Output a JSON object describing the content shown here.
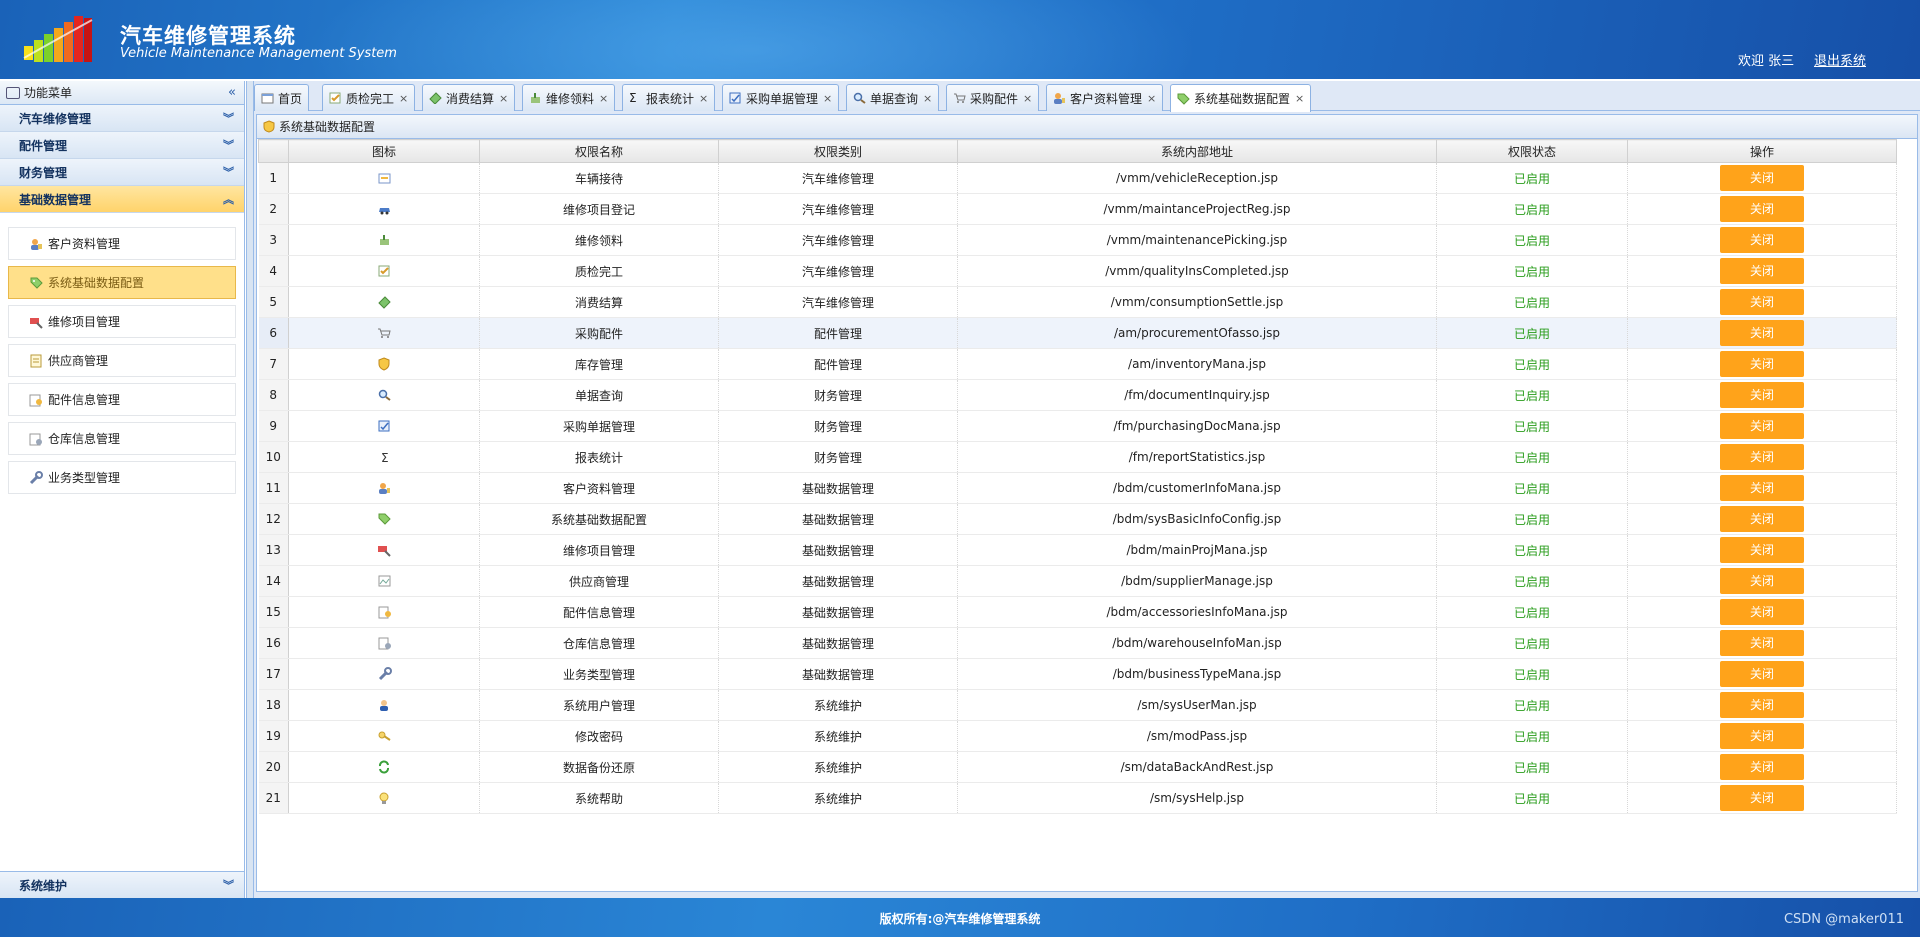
{
  "header": {
    "title": "汽车维修管理系统",
    "subtitle": "Vehicle Maintenance Management System",
    "welcome": "欢迎 张三",
    "logout": "退出系统"
  },
  "sidebar": {
    "title": "功能菜单",
    "panels": [
      {
        "label": "汽车维修管理"
      },
      {
        "label": "配件管理"
      },
      {
        "label": "财务管理"
      },
      {
        "label": "基础数据管理"
      }
    ],
    "items": [
      {
        "label": "客户资料管理",
        "icon": "customer-icon"
      },
      {
        "label": "系统基础数据配置",
        "icon": "tag-icon"
      },
      {
        "label": "维修项目管理",
        "icon": "repair-icon"
      },
      {
        "label": "供应商管理",
        "icon": "document-icon"
      },
      {
        "label": "配件信息管理",
        "icon": "parts-icon"
      },
      {
        "label": "仓库信息管理",
        "icon": "warehouse-icon"
      },
      {
        "label": "业务类型管理",
        "icon": "wrench-icon"
      }
    ],
    "footer_panel": "系统维护"
  },
  "tabs": [
    {
      "label": "首页",
      "icon": "home-icon",
      "closable": false
    },
    {
      "label": "质检完工",
      "icon": "check-icon",
      "closable": true
    },
    {
      "label": "消费结算",
      "icon": "money-icon",
      "closable": true
    },
    {
      "label": "维修领料",
      "icon": "picking-icon",
      "closable": true
    },
    {
      "label": "报表统计",
      "icon": "sigma-icon",
      "closable": true
    },
    {
      "label": "采购单据管理",
      "icon": "doc-icon",
      "closable": true
    },
    {
      "label": "单据查询",
      "icon": "search-icon",
      "closable": true
    },
    {
      "label": "采购配件",
      "icon": "cart-icon",
      "closable": true
    },
    {
      "label": "客户资料管理",
      "icon": "customer-icon",
      "closable": true
    },
    {
      "label": "系统基础数据配置",
      "icon": "tag-icon",
      "closable": true
    }
  ],
  "content": {
    "title": "系统基础数据配置",
    "columns": [
      "图标",
      "权限名称",
      "权限类别",
      "系统内部地址",
      "权限状态",
      "操作"
    ],
    "rows": [
      {
        "no": "1",
        "icon": "reception-icon",
        "name": "车辆接待",
        "category": "汽车维修管理",
        "url": "/vmm/vehicleReception.jsp",
        "status": "已启用",
        "action": "关闭"
      },
      {
        "no": "2",
        "icon": "car-icon",
        "name": "维修项目登记",
        "category": "汽车维修管理",
        "url": "/vmm/maintanceProjectReg.jsp",
        "status": "已启用",
        "action": "关闭"
      },
      {
        "no": "3",
        "icon": "picking-icon",
        "name": "维修领料",
        "category": "汽车维修管理",
        "url": "/vmm/maintenancePicking.jsp",
        "status": "已启用",
        "action": "关闭"
      },
      {
        "no": "4",
        "icon": "check-icon",
        "name": "质检完工",
        "category": "汽车维修管理",
        "url": "/vmm/qualityInsCompleted.jsp",
        "status": "已启用",
        "action": "关闭"
      },
      {
        "no": "5",
        "icon": "money-icon",
        "name": "消费结算",
        "category": "汽车维修管理",
        "url": "/vmm/consumptionSettle.jsp",
        "status": "已启用",
        "action": "关闭"
      },
      {
        "no": "6",
        "icon": "cart-icon",
        "name": "采购配件",
        "category": "配件管理",
        "url": "/am/procurementOfasso.jsp",
        "status": "已启用",
        "action": "关闭"
      },
      {
        "no": "7",
        "icon": "shield-icon",
        "name": "库存管理",
        "category": "配件管理",
        "url": "/am/inventoryMana.jsp",
        "status": "已启用",
        "action": "关闭"
      },
      {
        "no": "8",
        "icon": "search-icon",
        "name": "单据查询",
        "category": "财务管理",
        "url": "/fm/documentInquiry.jsp",
        "status": "已启用",
        "action": "关闭"
      },
      {
        "no": "9",
        "icon": "doc-icon",
        "name": "采购单据管理",
        "category": "财务管理",
        "url": "/fm/purchasingDocMana.jsp",
        "status": "已启用",
        "action": "关闭"
      },
      {
        "no": "10",
        "icon": "sigma-icon",
        "name": "报表统计",
        "category": "财务管理",
        "url": "/fm/reportStatistics.jsp",
        "status": "已启用",
        "action": "关闭"
      },
      {
        "no": "11",
        "icon": "customer-icon",
        "name": "客户资料管理",
        "category": "基础数据管理",
        "url": "/bdm/customerInfoMana.jsp",
        "status": "已启用",
        "action": "关闭"
      },
      {
        "no": "12",
        "icon": "tag-icon",
        "name": "系统基础数据配置",
        "category": "基础数据管理",
        "url": "/bdm/sysBasicInfoConfig.jsp",
        "status": "已启用",
        "action": "关闭"
      },
      {
        "no": "13",
        "icon": "repair-icon",
        "name": "维修项目管理",
        "category": "基础数据管理",
        "url": "/bdm/mainProjMana.jsp",
        "status": "已启用",
        "action": "关闭"
      },
      {
        "no": "14",
        "icon": "broken-image-icon",
        "name": "供应商管理",
        "category": "基础数据管理",
        "url": "/bdm/supplierManage.jsp",
        "status": "已启用",
        "action": "关闭"
      },
      {
        "no": "15",
        "icon": "parts-icon",
        "name": "配件信息管理",
        "category": "基础数据管理",
        "url": "/bdm/accessoriesInfoMana.jsp",
        "status": "已启用",
        "action": "关闭"
      },
      {
        "no": "16",
        "icon": "warehouse-icon",
        "name": "仓库信息管理",
        "category": "基础数据管理",
        "url": "/bdm/warehouseInfoMan.jsp",
        "status": "已启用",
        "action": "关闭"
      },
      {
        "no": "17",
        "icon": "wrench-icon",
        "name": "业务类型管理",
        "category": "基础数据管理",
        "url": "/bdm/businessTypeMana.jsp",
        "status": "已启用",
        "action": "关闭"
      },
      {
        "no": "18",
        "icon": "user-icon",
        "name": "系统用户管理",
        "category": "系统维护",
        "url": "/sm/sysUserMan.jsp",
        "status": "已启用",
        "action": "关闭"
      },
      {
        "no": "19",
        "icon": "key-icon",
        "name": "修改密码",
        "category": "系统维护",
        "url": "/sm/modPass.jsp",
        "status": "已启用",
        "action": "关闭"
      },
      {
        "no": "20",
        "icon": "refresh-icon",
        "name": "数据备份还原",
        "category": "系统维护",
        "url": "/sm/dataBackAndRest.jsp",
        "status": "已启用",
        "action": "关闭"
      },
      {
        "no": "21",
        "icon": "bulb-icon",
        "name": "系统帮助",
        "category": "系统维护",
        "url": "/sm/sysHelp.jsp",
        "status": "已启用",
        "action": "关闭"
      }
    ]
  },
  "footer": {
    "copyright": "版权所有:@汽车维修管理系统",
    "watermark": "CSDN @maker011"
  },
  "colors": {
    "header_blue": "#1f6ec6",
    "active_panel": "#ffd36b",
    "status_green": "#2a9d1c",
    "button_orange": "#ffa31a"
  }
}
